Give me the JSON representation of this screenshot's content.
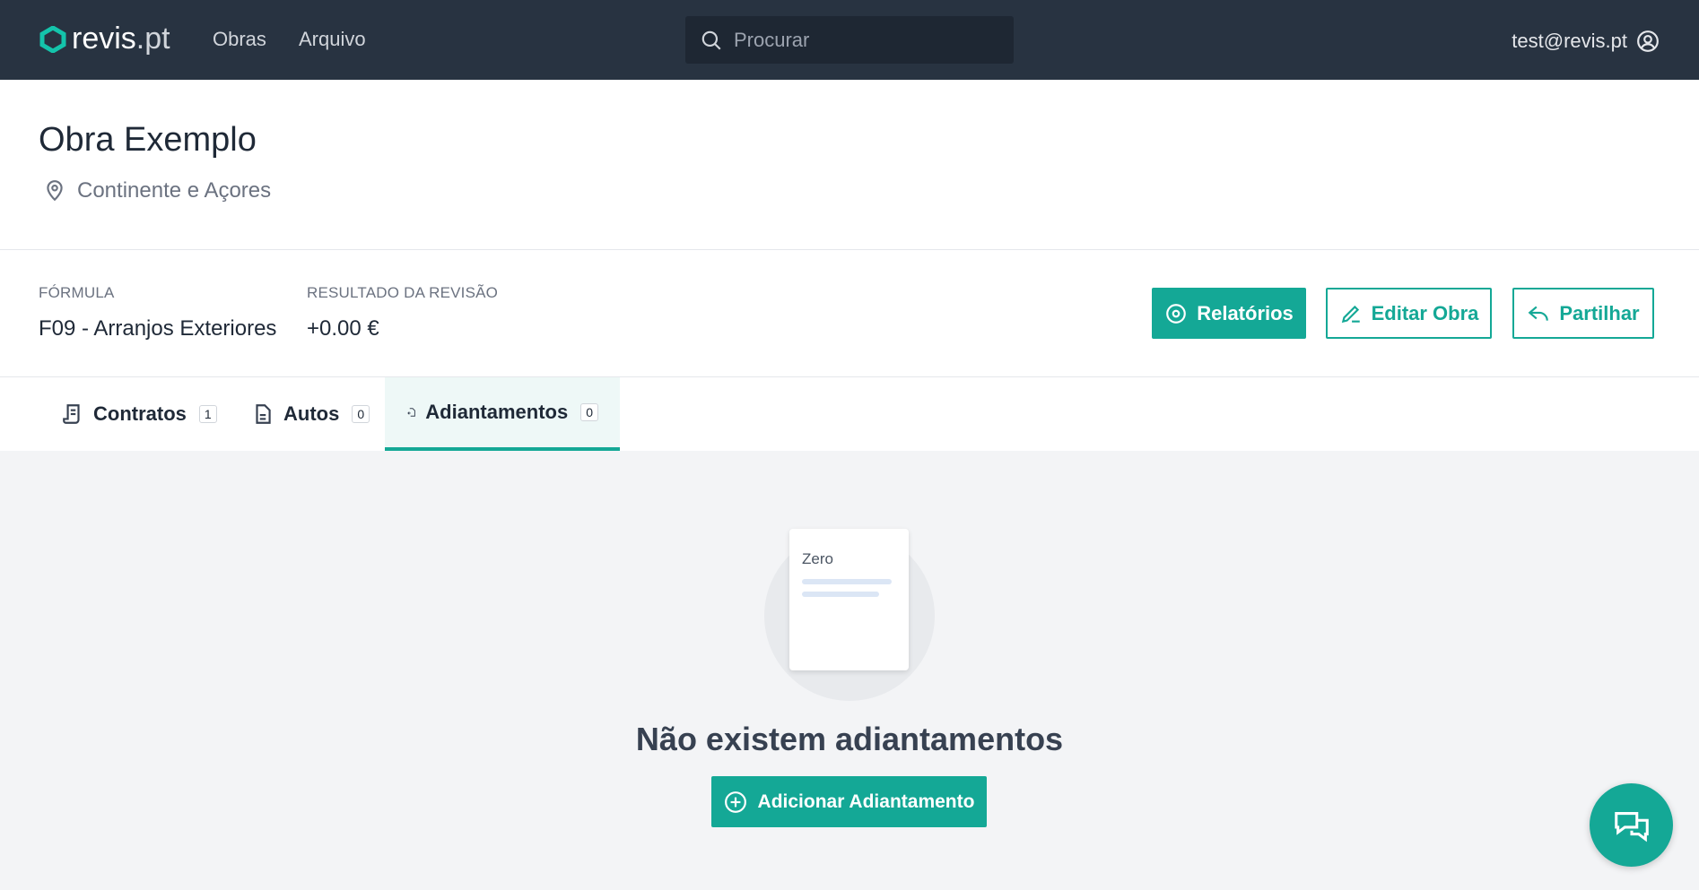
{
  "nav": {
    "brand_main": "revis",
    "brand_tld": ".pt",
    "links": [
      "Obras",
      "Arquivo"
    ],
    "search_placeholder": "Procurar",
    "user_email": "test@revis.pt"
  },
  "header": {
    "title": "Obra Exemplo",
    "location": "Continente e Açores"
  },
  "info": {
    "formula_label": "FÓRMULA",
    "formula_value": "F09 - Arranjos Exteriores",
    "result_label": "RESULTADO DA REVISÃO",
    "result_value": "+0.00 €"
  },
  "actions": {
    "reports": "Relatórios",
    "edit": "Editar Obra",
    "share": "Partilhar"
  },
  "tabs": [
    {
      "label": "Contratos",
      "count": "1"
    },
    {
      "label": "Autos",
      "count": "0"
    },
    {
      "label": "Adiantamentos",
      "count": "0"
    }
  ],
  "empty": {
    "card_text": "Zero",
    "title": "Não existem adiantamentos",
    "button": "Adicionar Adiantamento"
  },
  "colors": {
    "accent": "#14a896",
    "topbar": "#283341"
  }
}
